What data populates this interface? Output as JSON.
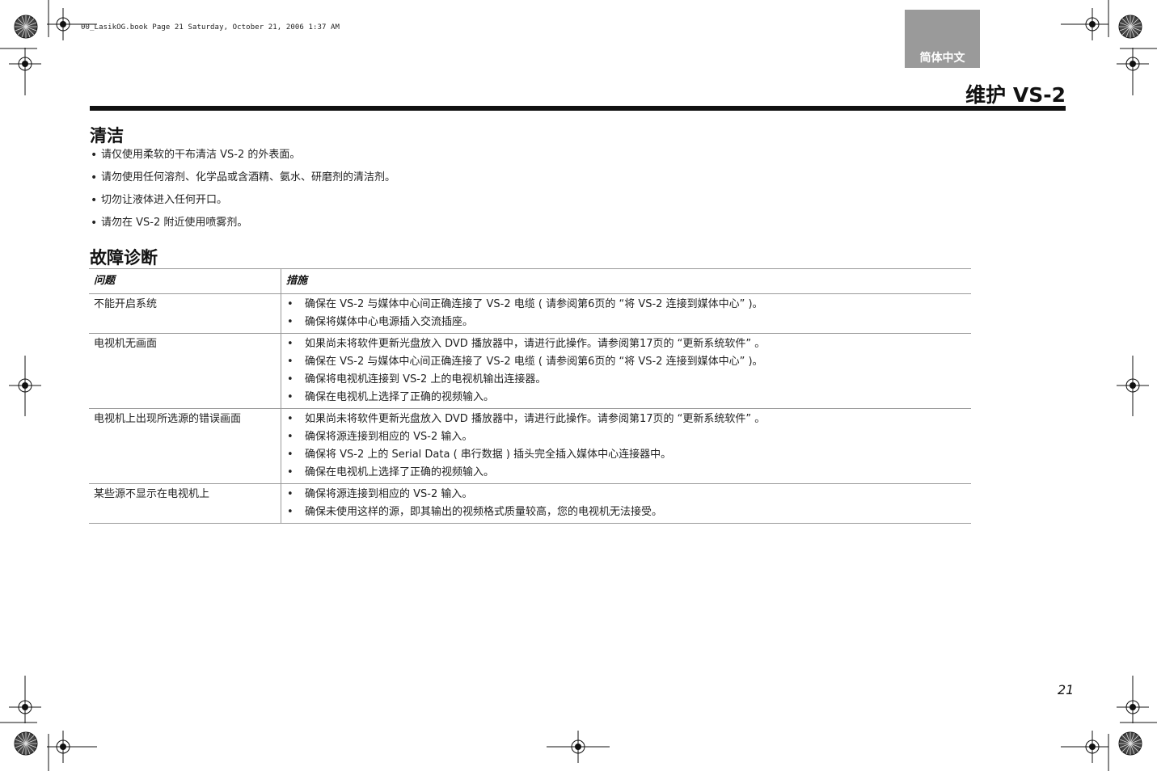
{
  "header": {
    "meta_line": "00_LasikOG.book  Page 21  Saturday, October 21, 2006  1:37 AM",
    "language_tab": "简体中文",
    "page_title": "维护 VS-2"
  },
  "cleaning": {
    "heading": "清洁",
    "items": [
      "请仅使用柔软的干布清洁 VS-2 的外表面。",
      "请勿使用任何溶剂、化学品或含酒精、氨水、研磨剂的清洁剂。",
      "切勿让液体进入任何开口。",
      "请勿在 VS-2 附近使用喷雾剂。"
    ]
  },
  "troubleshooting": {
    "heading": "故障诊断",
    "col_problem": "问题",
    "col_action": "措施",
    "rows": [
      {
        "problem": "不能开启系统",
        "actions": [
          "确保在 VS-2 与媒体中心间正确连接了 VS-2 电缆 ( 请参阅第6页的 “将 VS-2 连接到媒体中心” )。",
          "确保将媒体中心电源插入交流插座。"
        ]
      },
      {
        "problem": "电视机无画面",
        "actions": [
          "如果尚未将软件更新光盘放入 DVD 播放器中，请进行此操作。请参阅第17页的 “更新系统软件” 。",
          "确保在 VS-2 与媒体中心间正确连接了 VS-2 电缆 ( 请参阅第6页的 “将 VS-2 连接到媒体中心” )。",
          "确保将电视机连接到 VS-2 上的电视机输出连接器。",
          "确保在电视机上选择了正确的视频输入。"
        ]
      },
      {
        "problem": "电视机上出现所选源的错误画面",
        "actions": [
          "如果尚未将软件更新光盘放入 DVD 播放器中，请进行此操作。请参阅第17页的 “更新系统软件” 。",
          "确保将源连接到相应的 VS-2 输入。",
          "确保将 VS-2 上的 Serial Data ( 串行数据 ) 插头完全插入媒体中心连接器中。",
          "确保在电视机上选择了正确的视频输入。"
        ]
      },
      {
        "problem": "某些源不显示在电视机上",
        "actions": [
          "确保将源连接到相应的 VS-2 输入。",
          "确保未使用这样的源，即其输出的视频格式质量较高，您的电视机无法接受。"
        ]
      }
    ]
  },
  "footer": {
    "page_number": "21"
  }
}
